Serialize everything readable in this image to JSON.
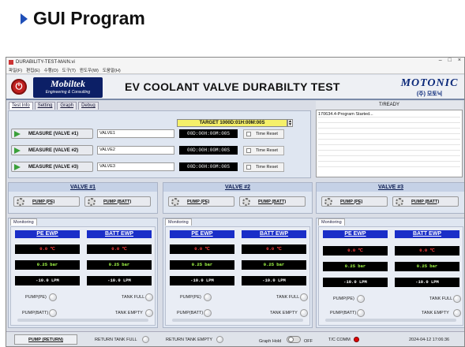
{
  "slide": {
    "title": "GUI Program"
  },
  "window": {
    "title": "DURABILITY-TEST-MAIN.vi",
    "controls": [
      "–",
      "□",
      "×"
    ],
    "menu": [
      "파일(F)",
      "편집(E)",
      "수행(O)",
      "도구(T)",
      "윈도우(W)",
      "도움말(H)"
    ]
  },
  "header": {
    "brand_left": "Mobiltek",
    "brand_left_sub": "Engineering & Consulting",
    "app_title": "EV COOLANT VALVE DURABILTY TEST",
    "brand_right": "MOTONIC",
    "brand_right_sub": "(주) 모토닉"
  },
  "tabs": [
    "Test Info",
    "Setting",
    "Graph",
    "Debug"
  ],
  "target": "TARGET 1000D:01H:00M:00S",
  "measure_rows": [
    {
      "button": "MEASURE (VALVE #1)",
      "input": "VALVE1",
      "time": "00D:00H:00M:00S",
      "reset": "Time Reset"
    },
    {
      "button": "MEASURE (VALVE #2)",
      "input": "VALVE2",
      "time": "00D:00H:00M:00S",
      "reset": "Time Reset"
    },
    {
      "button": "MEASURE (VALVE #3)",
      "input": "VALVE3",
      "time": "00D:00H:00M:00S",
      "reset": "Time Reset"
    }
  ],
  "status": {
    "label": "T/READY",
    "log": [
      "170634.4-Program Started..."
    ]
  },
  "valves": [
    {
      "title": "VALVE #1",
      "pump_pe": "PUMP (PE)",
      "pump_batt": "PUMP (BATT)",
      "monitoring_tab": "Monitoring",
      "pe_head": "PE EWP",
      "batt_head": "BATT EWP",
      "pe_temp": "0.0 ℃",
      "batt_temp": "0.0 ℃",
      "pe_pressure": "0.25 bar",
      "batt_pressure": "0.25 bar",
      "pe_flow": "-10.0 LPM",
      "batt_flow": "-10.0 LPM",
      "ind_pump_pe": "PUMP(PE)",
      "ind_pump_batt": "PUMP(BATT)",
      "ind_tank_full": "TANK FULL",
      "ind_tank_empty": "TANK EMPTY"
    },
    {
      "title": "VALVE #2",
      "pump_pe": "PUMP (PE)",
      "pump_batt": "PUMP (BATT)",
      "monitoring_tab": "Monitoring",
      "pe_head": "PE EWP",
      "batt_head": "BATT EWP",
      "pe_temp": "0.0 ℃",
      "batt_temp": "0.0 ℃",
      "pe_pressure": "0.25 bar",
      "batt_pressure": "0.25 bar",
      "pe_flow": "-10.0 LPM",
      "batt_flow": "-10.0 LPM",
      "ind_pump_pe": "PUMP(PE)",
      "ind_pump_batt": "PUMP(BATT)",
      "ind_tank_full": "TANK FULL",
      "ind_tank_empty": "TANK EMPTY"
    },
    {
      "title": "VALVE #3",
      "pump_pe": "PUMP (PE)",
      "pump_batt": "PUMP (BATT)",
      "monitoring_tab": "Monitoring",
      "pe_head": "PE EWP",
      "batt_head": "BATT EWP",
      "pe_temp": "0.0 ℃",
      "batt_temp": "0.0 ℃",
      "pe_pressure": "0.25 bar",
      "batt_pressure": "0.25 bar",
      "pe_flow": "-10.0 LPM",
      "batt_flow": "-10.0 LPM",
      "ind_pump_pe": "PUMP(PE)",
      "ind_pump_batt": "PUMP(BATT)",
      "ind_tank_full": "TANK FULL",
      "ind_tank_empty": "TANK EMPTY"
    }
  ],
  "bottom": {
    "pump_return": "PUMP (RETURN)",
    "return_tank_full": "RETURN TANK FULL",
    "return_tank_empty": "RETURN TANK EMPTY",
    "graph_hold": "Graph Hold",
    "graph_hold_state": "OFF",
    "tc_comm": "T/C COMM",
    "datetime": "2024-04-12 17:06:36"
  },
  "colors": {
    "header_blue": "#1a2ec8",
    "temp_red": "#ff4040",
    "pressure_green": "#a6ff4a",
    "tc_comm_led": "#e00000",
    "target_yellow": "#f5f06a"
  }
}
